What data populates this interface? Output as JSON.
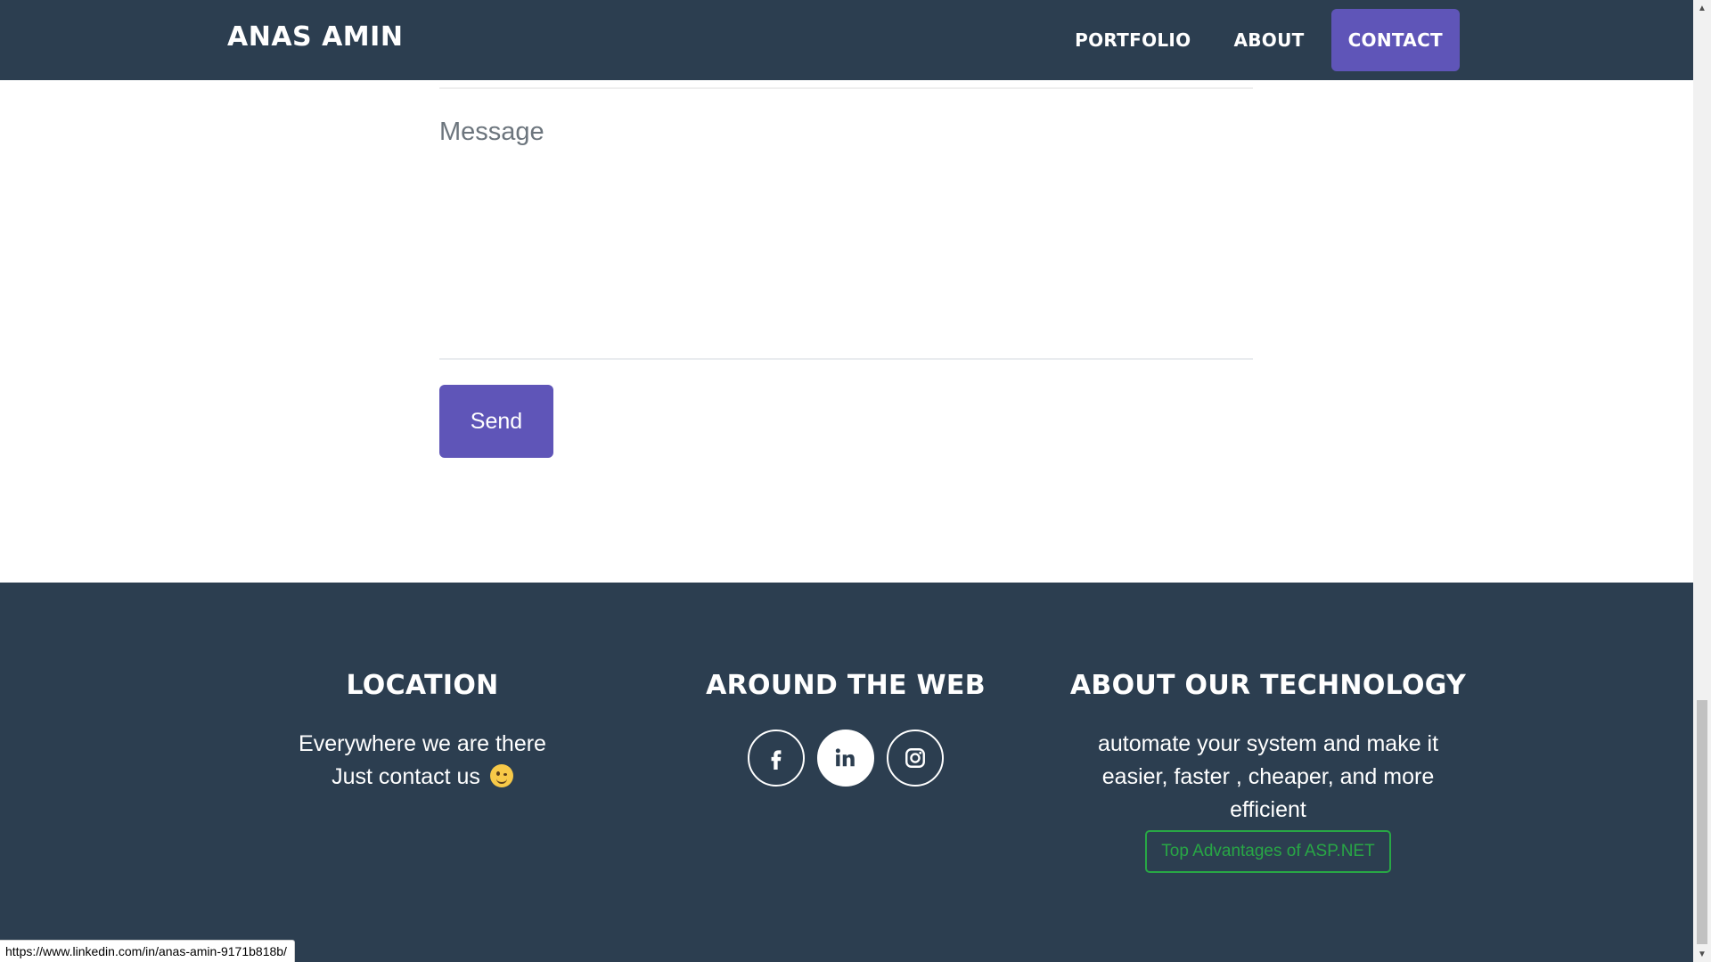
{
  "navbar": {
    "brand": "ANAS AMIN",
    "links": [
      {
        "label": "PORTFOLIO"
      },
      {
        "label": "ABOUT"
      },
      {
        "label": "CONTACT"
      }
    ],
    "active_link": "CONTACT"
  },
  "form": {
    "message_placeholder": "Message",
    "message_value": "",
    "send_label": "Send"
  },
  "footer": {
    "location": {
      "heading": "LOCATION",
      "line1": "Everywhere we are there",
      "line2": "Just contact us"
    },
    "web": {
      "heading": "AROUND THE WEB",
      "socials": [
        {
          "icon": "facebook-icon"
        },
        {
          "icon": "linkedin-icon"
        },
        {
          "icon": "instagram-icon"
        }
      ]
    },
    "tech": {
      "heading": "ABOUT OUR TECHNOLOGY",
      "text": "automate your system and make it easier, faster , cheaper, and more efficient",
      "button_label": "Top Advantages of ASP.NET"
    }
  },
  "status_bar": {
    "url": "https://www.linkedin.com/in/anas-amin-9171b818b/"
  },
  "colors": {
    "navy": "#2c3e50",
    "accent": "#5f55b8",
    "green": "#28a745",
    "white": "#ffffff"
  }
}
